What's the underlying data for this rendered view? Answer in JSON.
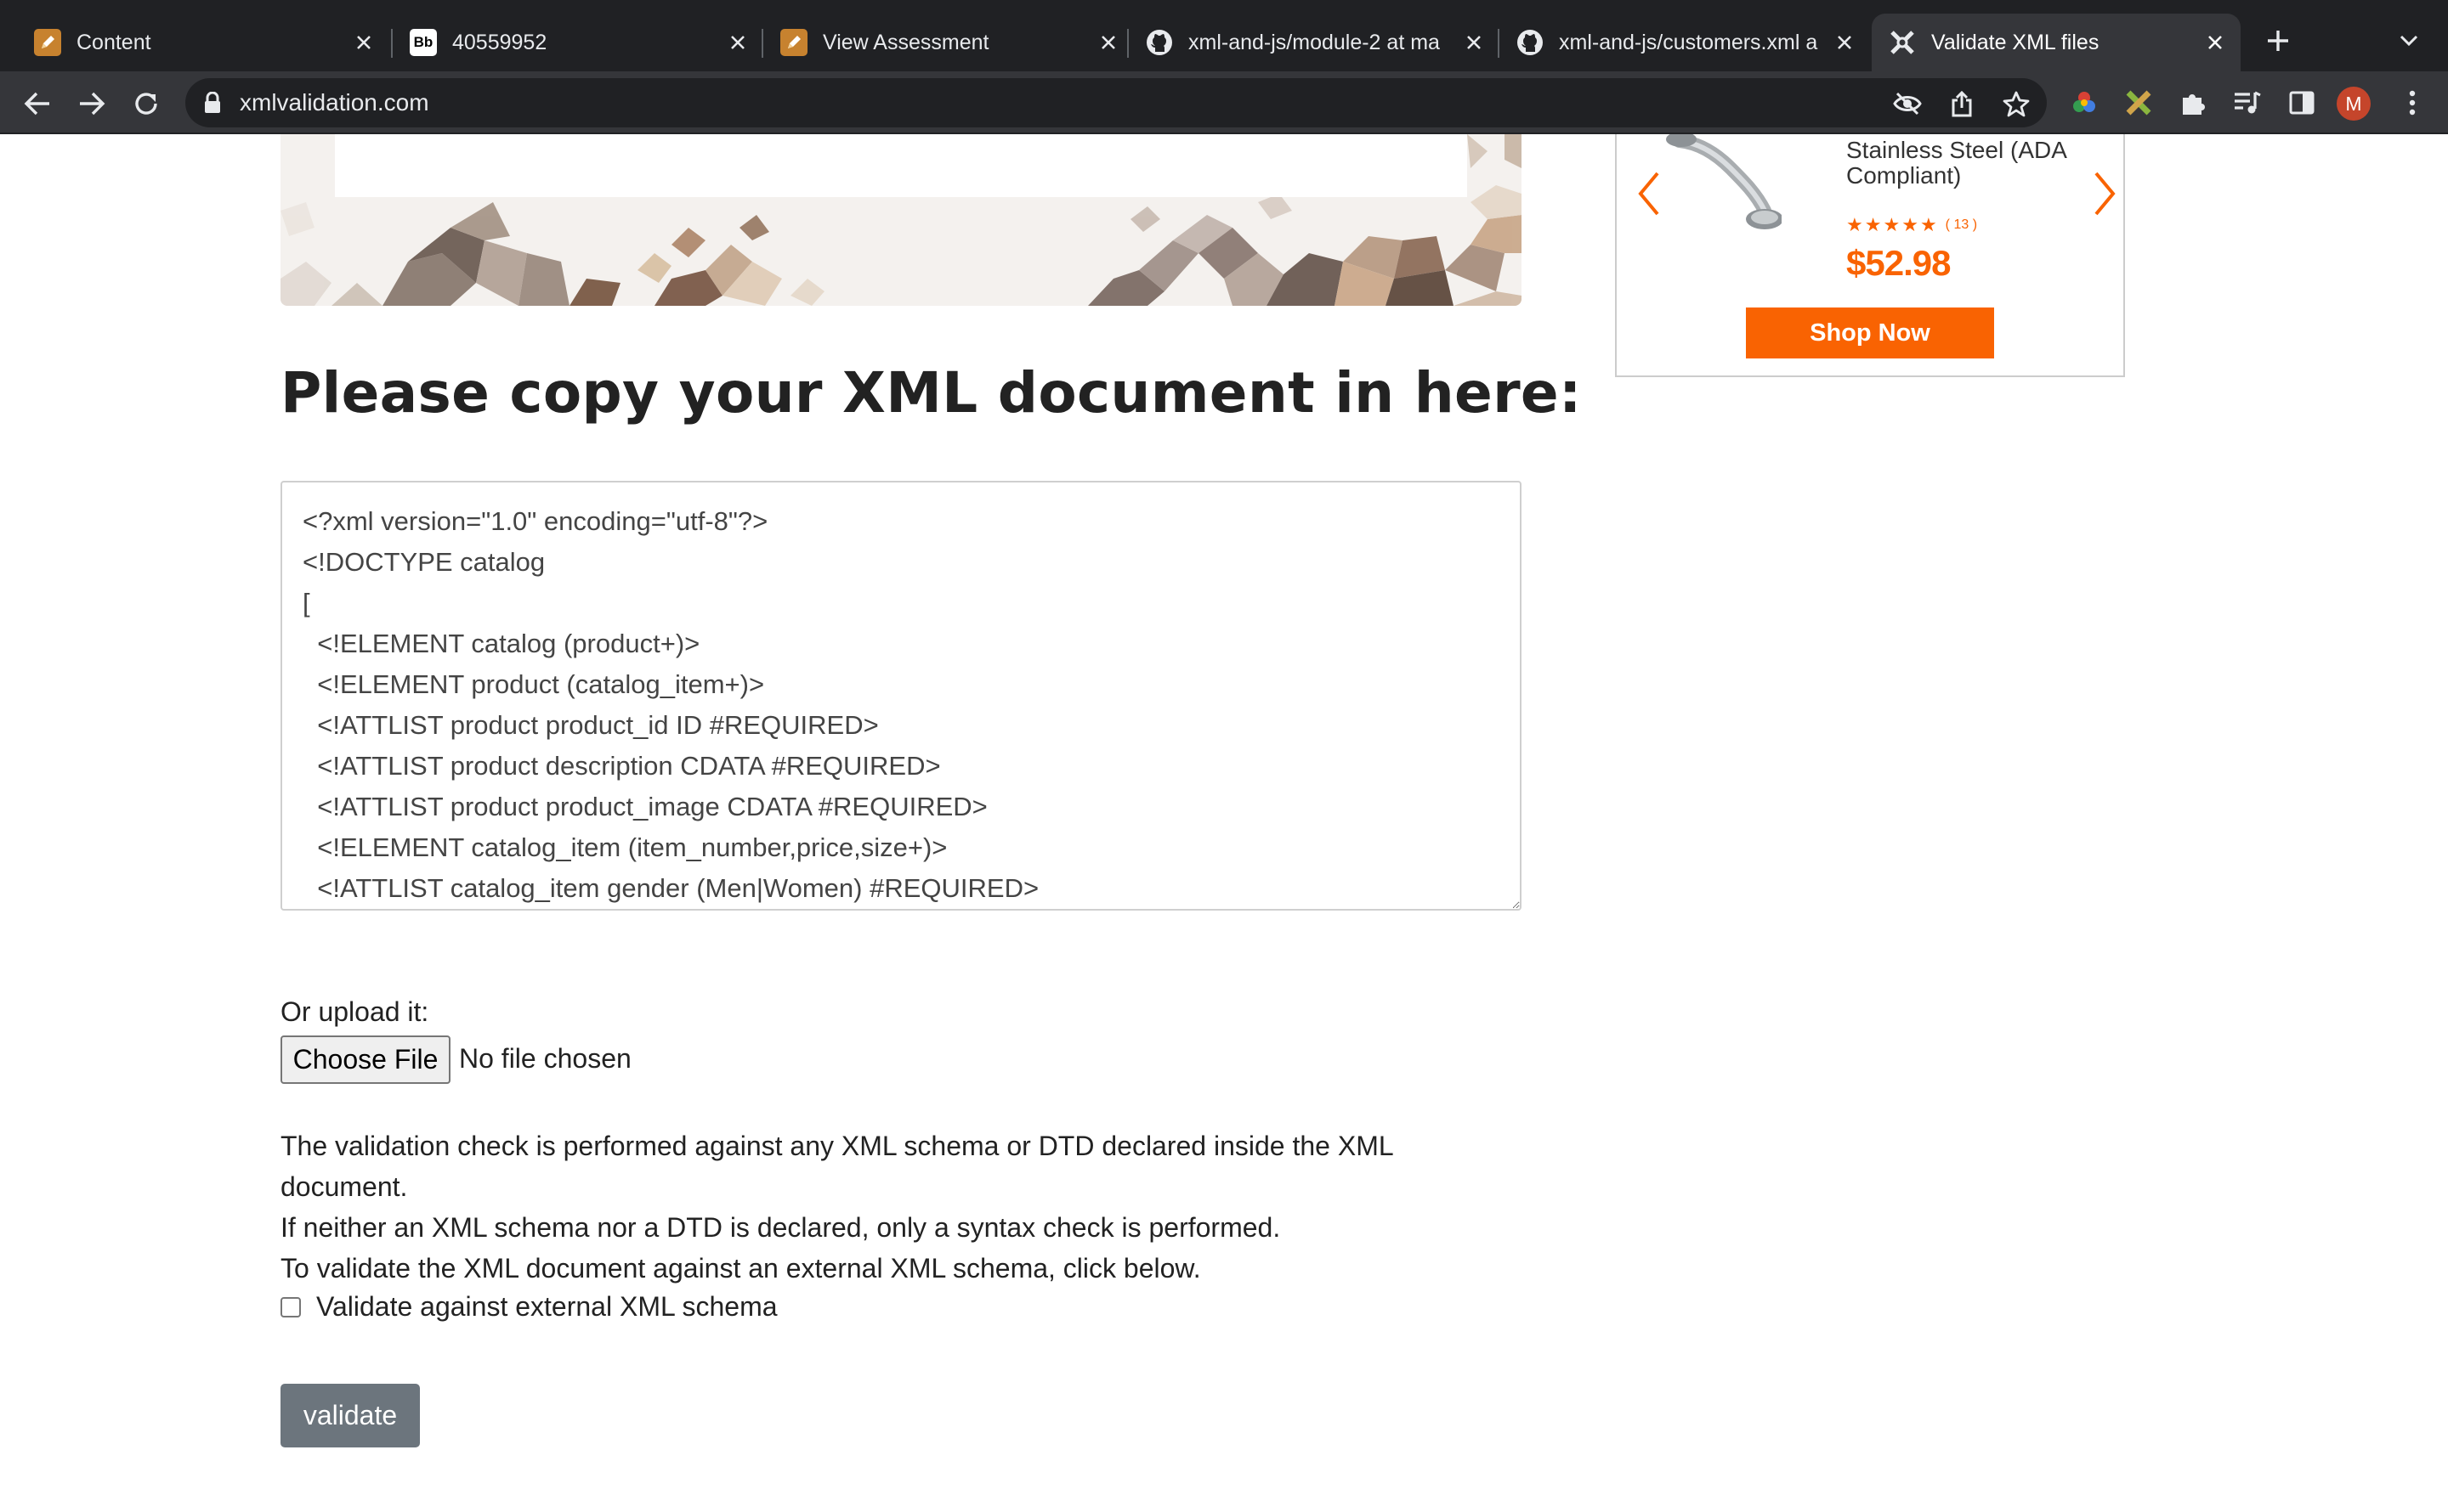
{
  "browser": {
    "tabs": [
      {
        "title": "Content",
        "icon": "pencil-icon"
      },
      {
        "title": "40559952",
        "icon": "blackboard-icon",
        "icon_text": "Bb"
      },
      {
        "title": "View Assessment",
        "icon": "pencil-icon"
      },
      {
        "title": "xml-and-js/module-2 at ma",
        "icon": "github-icon"
      },
      {
        "title": "xml-and-js/customers.xml a",
        "icon": "github-icon"
      },
      {
        "title": "Validate XML files",
        "icon": "xmlvalidation-icon",
        "active": true
      }
    ],
    "url": "xmlvalidation.com",
    "avatar_initial": "M"
  },
  "main": {
    "heading": "Please copy your XML document in here:",
    "xml_text": "<?xml version=\"1.0\" encoding=\"utf-8\"?>\n<!DOCTYPE catalog\n[\n  <!ELEMENT catalog (product+)>\n  <!ELEMENT product (catalog_item+)>\n  <!ATTLIST product product_id ID #REQUIRED>\n  <!ATTLIST product description CDATA #REQUIRED>\n  <!ATTLIST product product_image CDATA #REQUIRED>\n  <!ELEMENT catalog_item (item_number,price,size+)>\n  <!ATTLIST catalog_item gender (Men|Women) #REQUIRED>",
    "upload_label": "Or upload it:",
    "choose_file_label": "Choose File",
    "file_status": "No file chosen",
    "info_lines": [
      "The validation check is performed against any XML schema or DTD declared inside the XML document.",
      "If neither an XML schema nor a DTD is declared, only a syntax check is performed.",
      "To validate the XML document against an external XML schema, click below."
    ],
    "external_schema_label": "Validate against external XML schema",
    "external_schema_checked": false,
    "validate_label": "validate"
  },
  "ad": {
    "product_name": "Stainless Steel (ADA Compliant)",
    "rating": 5,
    "review_count": "( 13 )",
    "price": "$52.98",
    "button_label": "Shop Now",
    "accent_color": "#f96302"
  }
}
